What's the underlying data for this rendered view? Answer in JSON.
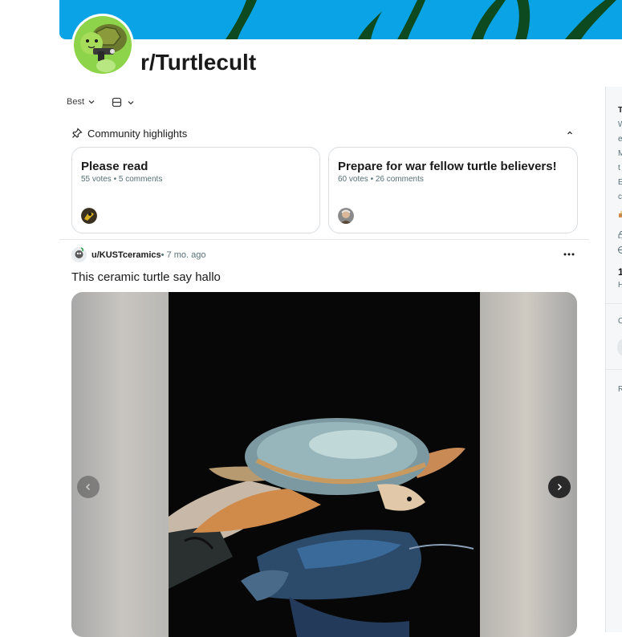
{
  "subreddit": {
    "name": "r/Turtlecult"
  },
  "feed": {
    "sort_label": "Best"
  },
  "highlights": {
    "label": "Community highlights",
    "cards": [
      {
        "title": "Please read",
        "meta": "55 votes • 5 comments"
      },
      {
        "title": "Prepare for war fellow turtle believers!",
        "meta": "60 votes • 26 comments"
      }
    ]
  },
  "post": {
    "user": "u/KUSTceramics",
    "time": " • 7 mo. ago",
    "title": "This ceramic turtle say hallo"
  },
  "sidebar": {
    "t1": "T",
    "t2": "W",
    "t3": "e",
    "t4": "M",
    "t5": "t",
    "t6": "E",
    "t7": "c",
    "n1": "1",
    "n2": "H",
    "c1": "C",
    "r1": "R"
  },
  "icons": {
    "sort": "chevron-down-icon",
    "view": "view-card-icon",
    "pin": "pin-icon",
    "collapse": "chevron-up-icon",
    "prev": "chevron-left-icon",
    "next": "chevron-right-icon"
  },
  "colors": {
    "banner": "#0aa3e6",
    "avatar_bg": "#8ed44a",
    "text": "#1a1a1b",
    "meta": "#576f76"
  }
}
